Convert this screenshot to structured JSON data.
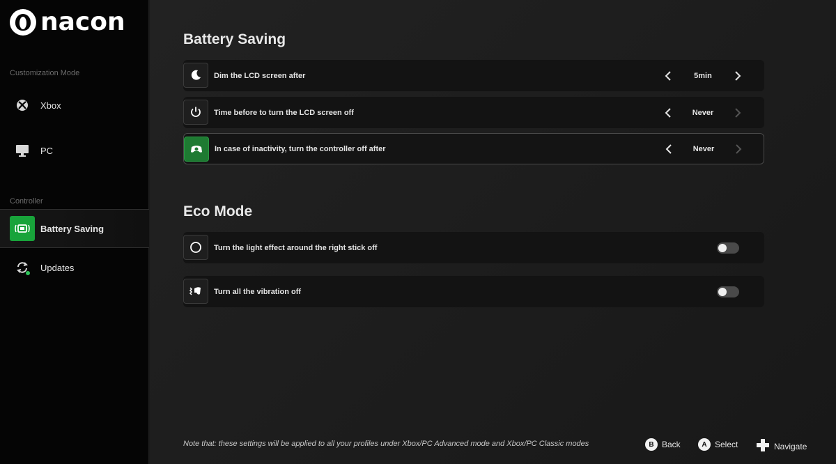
{
  "brand": {
    "name": "nacon"
  },
  "sidebar": {
    "section_customization": "Customization Mode",
    "section_controller": "Controller",
    "items": [
      {
        "label": "Xbox",
        "icon": "xbox-icon"
      },
      {
        "label": "PC",
        "icon": "monitor-icon"
      },
      {
        "label": "Battery Saving",
        "icon": "battery-saving-icon",
        "active": true
      },
      {
        "label": "Updates",
        "icon": "updates-icon"
      }
    ]
  },
  "battery": {
    "title": "Battery Saving",
    "rows": [
      {
        "label": "Dim the LCD screen after",
        "value": "5min",
        "icon": "moon-icon"
      },
      {
        "label": "Time before to turn the LCD screen off",
        "value": "Never",
        "icon": "power-icon"
      },
      {
        "label": "In case of inactivity, turn the controller off after",
        "value": "Never",
        "icon": "controller-icon"
      }
    ]
  },
  "eco": {
    "title": "Eco Mode",
    "rows": [
      {
        "label": "Turn the light effect around the right stick off",
        "enabled": false,
        "icon": "stick-ring-icon"
      },
      {
        "label": "Turn all the vibration off",
        "enabled": false,
        "icon": "vibration-icon"
      }
    ]
  },
  "footer": {
    "note": "Note that: these settings will be applied to all your profiles under Xbox/PC Advanced mode and Xbox/PC Classic modes",
    "hints": [
      {
        "key": "B",
        "label": "Back"
      },
      {
        "key": "A",
        "label": "Select"
      },
      {
        "key": "dpad",
        "label": "Navigate"
      }
    ]
  },
  "colors": {
    "accent": "#18a33a",
    "background": "#1b1b1b",
    "sidebar": "#050505"
  }
}
